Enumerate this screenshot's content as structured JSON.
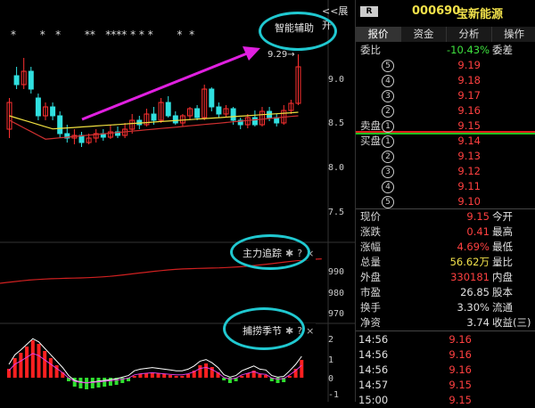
{
  "chart": {
    "expand_label": "<<展开",
    "smart_assist": "智能辅助",
    "main_track": "主力追踪",
    "capture_season": "捕捞季节",
    "gear_icon": "gear-icon",
    "help_icon": "?",
    "close_icon": "×",
    "high_marker": "9.29→",
    "price_axis": [
      "9.0",
      "8.5",
      "8.0",
      "7.5"
    ],
    "track_axis": [
      "990",
      "980",
      "970"
    ],
    "macd_axis": [
      "2",
      "1",
      "0",
      "-1"
    ],
    "star_row_1": "*       *   *       **   **** * * *       *  *",
    "star_row_2": "* *  *"
  },
  "header": {
    "badge": "R",
    "stock_code": "000690",
    "stock_name": "宝新能源",
    "tabs": [
      "报价",
      "资金",
      "分析",
      "操作"
    ]
  },
  "order_book": {
    "wei_bi_label": "委比",
    "wei_bi_value": "-10.43%",
    "wei_cha_label": "委差",
    "sell_label": "卖盘",
    "buy_label": "买盘",
    "sells": [
      {
        "num": "5",
        "price": "9.19"
      },
      {
        "num": "4",
        "price": "9.18"
      },
      {
        "num": "3",
        "price": "9.17"
      },
      {
        "num": "2",
        "price": "9.16"
      },
      {
        "num": "1",
        "price": "9.15"
      }
    ],
    "buys": [
      {
        "num": "1",
        "price": "9.14"
      },
      {
        "num": "2",
        "price": "9.13"
      },
      {
        "num": "3",
        "price": "9.12"
      },
      {
        "num": "4",
        "price": "9.11"
      },
      {
        "num": "5",
        "price": "9.10"
      }
    ]
  },
  "quote": [
    {
      "label": "现价",
      "value": "9.15",
      "color": "red",
      "label2": "今开"
    },
    {
      "label": "涨跌",
      "value": "0.41",
      "color": "red",
      "label2": "最高"
    },
    {
      "label": "涨幅",
      "value": "4.69%",
      "color": "red",
      "label2": "最低"
    },
    {
      "label": "总量",
      "value": "56.62万",
      "color": "yellow",
      "label2": "量比"
    },
    {
      "label": "外盘",
      "value": "330181",
      "color": "red",
      "label2": "内盘"
    },
    {
      "label": "市盈",
      "value": "26.85",
      "color": "white",
      "label2": "股本"
    },
    {
      "label": "换手",
      "value": "3.30%",
      "color": "white",
      "label2": "流通"
    },
    {
      "label": "净资",
      "value": "3.74",
      "color": "white",
      "label2": "收益(三)"
    }
  ],
  "ticks": [
    {
      "time": "14:56",
      "price": "9.16"
    },
    {
      "time": "14:56",
      "price": "9.16"
    },
    {
      "time": "14:56",
      "price": "9.16"
    },
    {
      "time": "14:57",
      "price": "9.15"
    },
    {
      "time": "15:00",
      "price": "9.15"
    }
  ],
  "colors": {
    "up": "#ff3030",
    "down": "#30e0e0",
    "ring": "#20c8d0",
    "arrow": "#e020e0"
  }
}
